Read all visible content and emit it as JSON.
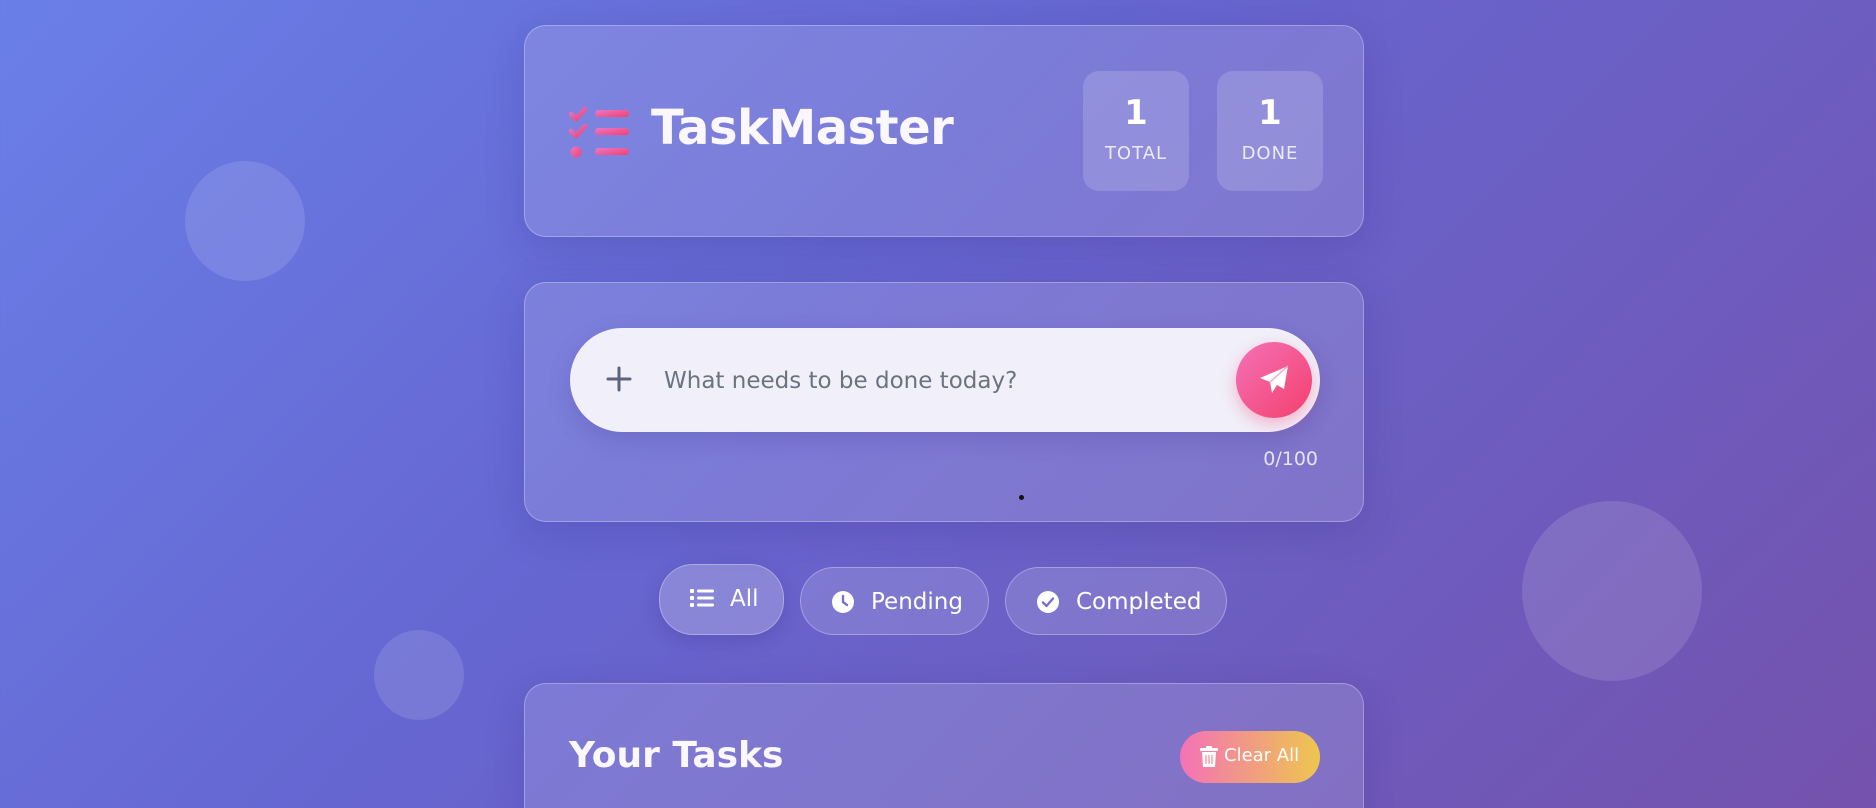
{
  "app": {
    "title": "TaskMaster",
    "logo_icon": "checklist-icon"
  },
  "stats": {
    "total_value": "1",
    "total_label": "TOTAL",
    "done_value": "1",
    "done_label": "DONE"
  },
  "task_input": {
    "placeholder": "What needs to be done today?",
    "value": "",
    "char_count": "0/100",
    "add_icon": "plus-icon",
    "submit_icon": "paper-plane-icon"
  },
  "filters": [
    {
      "label": "All",
      "icon": "list-icon",
      "active": true
    },
    {
      "label": "Pending",
      "icon": "clock-icon",
      "active": false
    },
    {
      "label": "Completed",
      "icon": "check-circle-icon",
      "active": false
    }
  ],
  "tasks_section": {
    "title": "Your Tasks",
    "clear_label": "Clear All",
    "clear_icon": "trash-icon"
  },
  "colors": {
    "accent_pink": "#f43f6e",
    "accent_gold": "#eec64e",
    "background_start": "#6a7fe8",
    "background_end": "#7452ad"
  }
}
